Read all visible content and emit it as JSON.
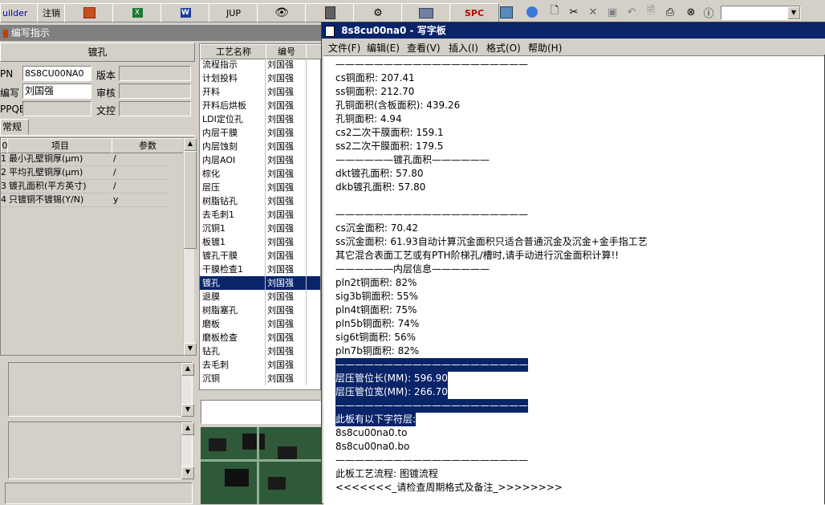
{
  "toolbar": {
    "builder_label": "uilder",
    "logout_label": "注销",
    "jup_label": "JUP",
    "spc_label": "SPC",
    "dropdown_value": ""
  },
  "left_window": {
    "title": "编写指示",
    "section_title": "镀孔",
    "fields": {
      "pn_label": "PN",
      "pn_value": "8S8CU00NA0",
      "version_label": "版本",
      "version_value": "",
      "writer_label": "编写",
      "writer_value": "刘国强",
      "review_label": "审核",
      "review_value": "",
      "ppqe_label": "PPQE",
      "ppqe_value": "",
      "control_label": "文控",
      "control_value": ""
    },
    "tab_label": "常规",
    "param_table": {
      "headers": [
        "0",
        "项目",
        "参数"
      ],
      "rows": [
        {
          "no": "1",
          "item": "最小孔壁铜厚(μm)",
          "param": "/"
        },
        {
          "no": "2",
          "item": "平均孔壁铜厚(μm)",
          "param": "/"
        },
        {
          "no": "3",
          "item": "镀孔面积(平方英寸)",
          "param": "/"
        },
        {
          "no": "4",
          "item": "只镀铜不镀锡(Y/N)",
          "param": "y"
        }
      ]
    }
  },
  "process_list": {
    "headers": [
      "工艺名称",
      "编号"
    ],
    "selected_index": 16,
    "rows": [
      {
        "name": "流程指示",
        "person": "刘国强"
      },
      {
        "name": "计划投料",
        "person": "刘国强"
      },
      {
        "name": "开料",
        "person": "刘国强"
      },
      {
        "name": "开料后烘板",
        "person": "刘国强"
      },
      {
        "name": "LDI定位孔",
        "person": "刘国强"
      },
      {
        "name": "内层干膜",
        "person": "刘国强"
      },
      {
        "name": "内层蚀刻",
        "person": "刘国强"
      },
      {
        "name": "内层AOI",
        "person": "刘国强"
      },
      {
        "name": "棕化",
        "person": "刘国强"
      },
      {
        "name": "层压",
        "person": "刘国强"
      },
      {
        "name": "树脂钻孔",
        "person": "刘国强"
      },
      {
        "name": "去毛刺1",
        "person": "刘国强"
      },
      {
        "name": "沉铜1",
        "person": "刘国强"
      },
      {
        "name": "板镀1",
        "person": "刘国强"
      },
      {
        "name": "镀孔干膜",
        "person": "刘国强"
      },
      {
        "name": "干膜检查1",
        "person": "刘国强"
      },
      {
        "name": "镀孔",
        "person": "刘国强"
      },
      {
        "name": "退膜",
        "person": "刘国强"
      },
      {
        "name": "树脂塞孔",
        "person": "刘国强"
      },
      {
        "name": "磨板",
        "person": "刘国强"
      },
      {
        "name": "磨板检查",
        "person": "刘国强"
      },
      {
        "name": "钻孔",
        "person": "刘国强"
      },
      {
        "name": "去毛刺",
        "person": "刘国强"
      },
      {
        "name": "沉铜",
        "person": "刘国强"
      }
    ]
  },
  "wordpad": {
    "title": "8s8cu00na0 - 写字板",
    "menu": [
      "文件(F)",
      "编辑(E)",
      "查看(V)",
      "插入(I)",
      "格式(O)",
      "帮助(H)"
    ],
    "lines": [
      {
        "text": "————————————————————",
        "hl": false
      },
      {
        "text": "cs铜面积: 207.41",
        "hl": false
      },
      {
        "text": "ss铜面积: 212.70",
        "hl": false
      },
      {
        "text": "孔铜面积(含板面积): 439.26",
        "hl": false
      },
      {
        "text": "孔铜面积: 4.94",
        "hl": false
      },
      {
        "text": "cs2二次干膜面积: 159.1",
        "hl": false
      },
      {
        "text": "ss2二次干膜面积: 179.5",
        "hl": false
      },
      {
        "text": "——————镀孔面积——————",
        "hl": false
      },
      {
        "text": "dkt镀孔面积: 57.80",
        "hl": false
      },
      {
        "text": "dkb镀孔面积: 57.80",
        "hl": false
      },
      {
        "text": "",
        "hl": false
      },
      {
        "text": "————————————————————",
        "hl": false
      },
      {
        "text": "cs沉金面积: 70.42",
        "hl": false
      },
      {
        "text": "ss沉金面积: 61.93自动计算沉金面积只适合普通沉金及沉金+金手指工艺",
        "hl": false
      },
      {
        "text": "其它混合表面工艺或有PTH阶梯孔/槽时,请手动进行沉金面积计算!!",
        "hl": false
      },
      {
        "text": "——————内层信息——————",
        "hl": false
      },
      {
        "text": "pln2t铜面积: 82%",
        "hl": false
      },
      {
        "text": "sig3b铜面积: 55%",
        "hl": false
      },
      {
        "text": "pln4t铜面积: 75%",
        "hl": false
      },
      {
        "text": "pln5b铜面积: 74%",
        "hl": false
      },
      {
        "text": "sig6t铜面积: 56%",
        "hl": false
      },
      {
        "text": "pln7b铜面积: 82%",
        "hl": false
      },
      {
        "text": "————————————————————",
        "hl": true
      },
      {
        "text": "层压管位长(MM): 596.90",
        "hl": true
      },
      {
        "text": "层压管位宽(MM): 266.70",
        "hl": true
      },
      {
        "text": "————————————————————",
        "hl": true
      },
      {
        "text": "此板有以下字符层:",
        "hl": true
      },
      {
        "text": "8s8cu00na0.to",
        "hl": false
      },
      {
        "text": "8s8cu00na0.bo",
        "hl": false
      },
      {
        "text": "————————————————————",
        "hl": false
      },
      {
        "text": "此板工艺流程: 图镀流程",
        "hl": false
      },
      {
        "text": "<<<<<<<_请检查周期格式及备注_>>>>>>>>",
        "hl": false
      }
    ]
  }
}
